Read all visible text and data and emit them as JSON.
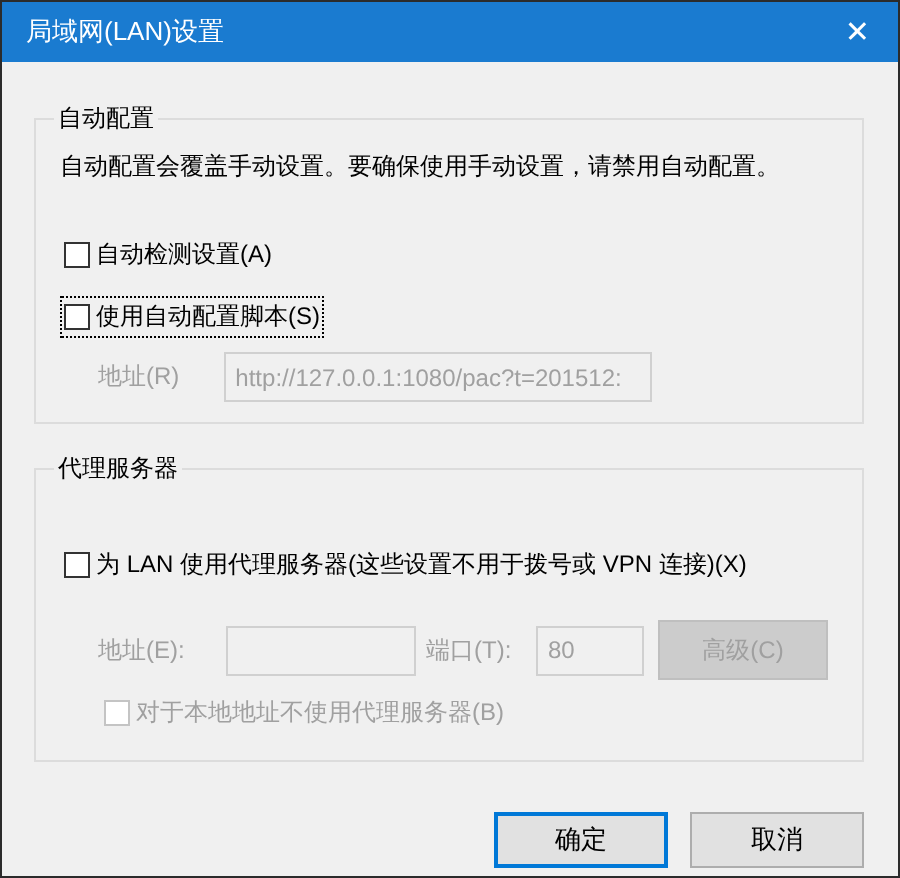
{
  "window": {
    "title": "局域网(LAN)设置",
    "close": "✕"
  },
  "auto_config": {
    "title": "自动配置",
    "description": "自动配置会覆盖手动设置。要确保使用手动设置，请禁用自动配置。",
    "options": [
      {
        "label": "自动检测设置(A)",
        "checked": false,
        "focused": false
      },
      {
        "label": "使用自动配置脚本(S)",
        "checked": false,
        "focused": true
      }
    ],
    "address": {
      "label": "地址(R)",
      "value": "http://127.0.0.1:1080/pac?t=201512:",
      "disabled": true
    }
  },
  "proxy": {
    "title": "代理服务器",
    "option": {
      "label": "为 LAN 使用代理服务器(这些设置不用于拨号或 VPN 连接)(X)",
      "checked": false
    },
    "address": {
      "label": "地址(E):",
      "disabled": true
    },
    "port": {
      "label": "端口(T):",
      "value": "80",
      "disabled": true
    },
    "advanced": {
      "label": "高级(C)",
      "disabled": true
    },
    "bypass": {
      "label": "对于本地地址不使用代理服务器(B)",
      "checked": false,
      "disabled": true
    }
  },
  "buttons": [
    {
      "label": "确定",
      "default": true
    },
    {
      "label": "取消",
      "default": false
    }
  ]
}
